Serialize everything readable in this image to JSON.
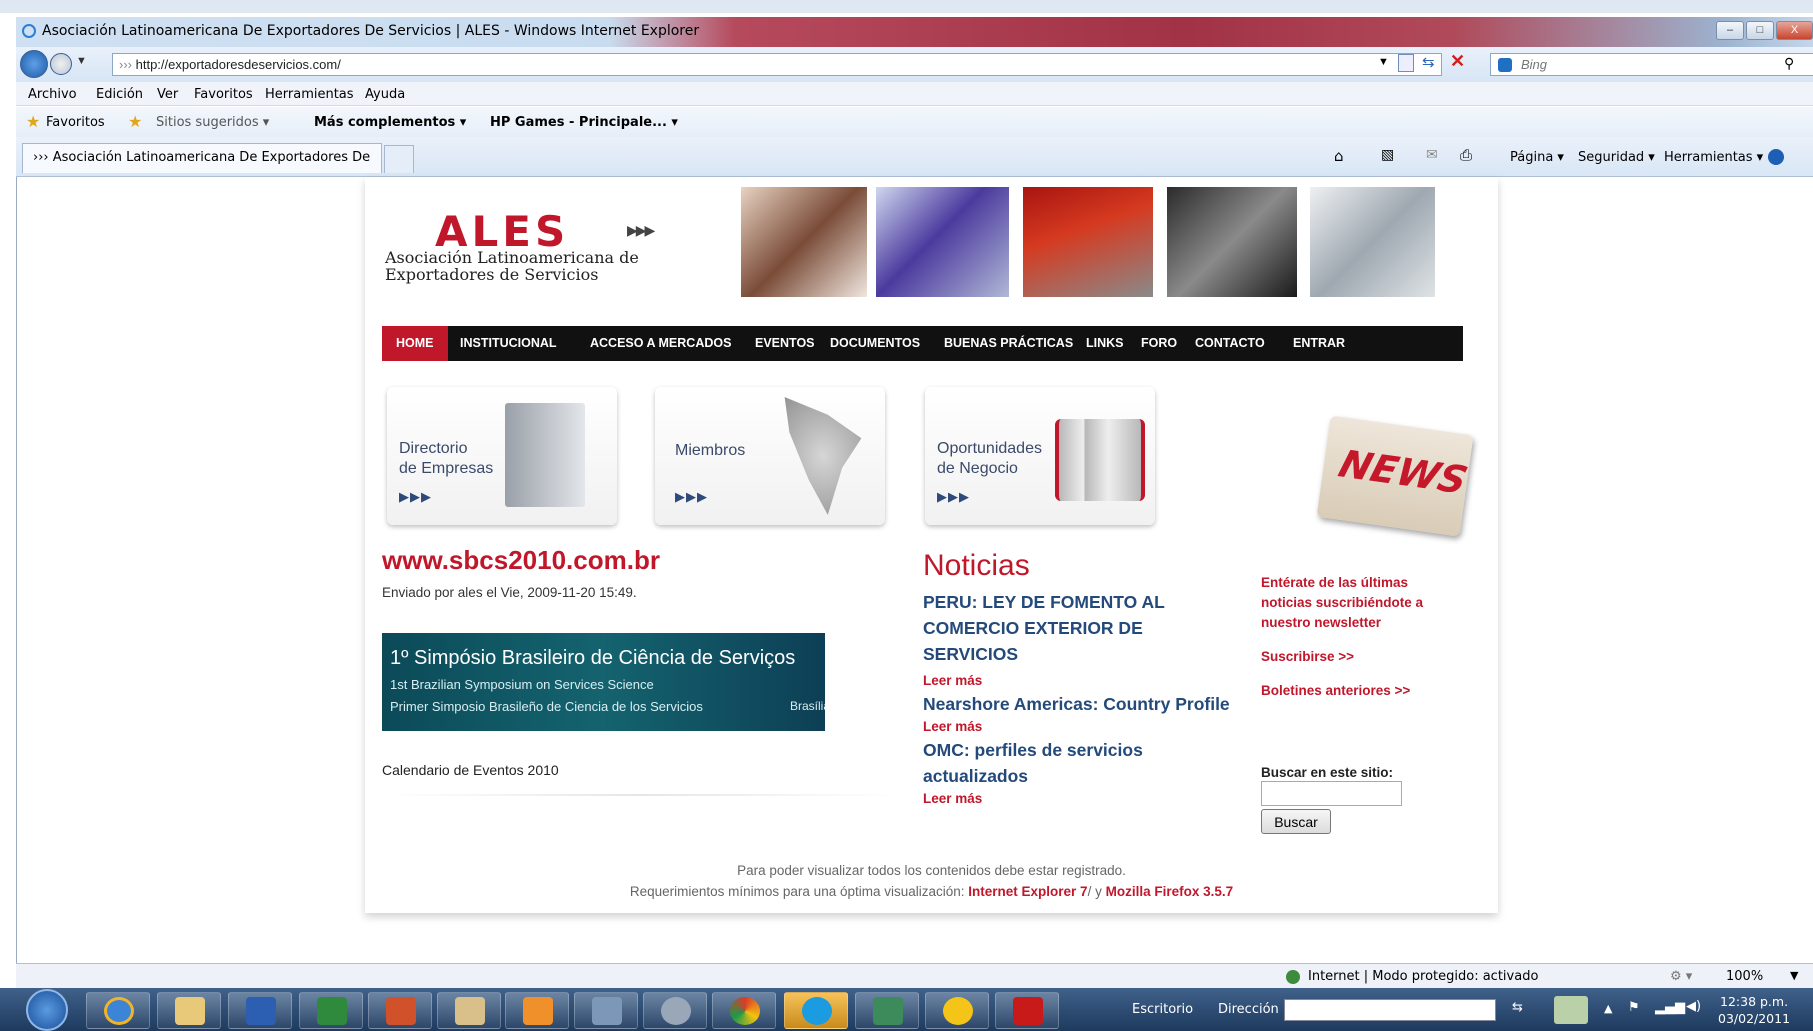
{
  "window": {
    "title": "Asociación Latinoamericana De Exportadores De Servicios | ALES - Windows Internet Explorer",
    "min": "–",
    "max": "□",
    "close": "X"
  },
  "nav": {
    "url": "http://exportadoresdeservicios.com/",
    "url_prefix": "›››",
    "search_placeholder": "Bing"
  },
  "menubar": [
    "Archivo",
    "Edición",
    "Ver",
    "Favoritos",
    "Herramientas",
    "Ayuda"
  ],
  "favbar": {
    "favoritos": "Favoritos",
    "sugeridos": "Sitios sugeridos ▾",
    "complementos": "Más complementos ▾",
    "hp": "HP Games - Principale... ▾"
  },
  "tab": {
    "label": "››› Asociación Latinoamericana De Exportadores De ..."
  },
  "cmdbar": {
    "pagina": "Página ▾",
    "seguridad": "Seguridad ▾",
    "herramientas": "Herramientas ▾"
  },
  "site": {
    "logo_word": "ALES",
    "logo_sub": "Asociación Latinoamericana de Exportadores de Servicios",
    "menu": [
      "HOME",
      "INSTITUCIONAL",
      "ACCESO A MERCADOS",
      "EVENTOS",
      "DOCUMENTOS",
      "BUENAS PRÁCTICAS",
      "LINKS",
      "FORO",
      "CONTACTO",
      "ENTRAR"
    ],
    "cards": [
      {
        "line1": "Directorio",
        "line2": "de Empresas",
        "arrows": "▶▶▶"
      },
      {
        "line1": "Miembros",
        "line2": "",
        "arrows": "▶▶▶"
      },
      {
        "line1": "Oportunidades",
        "line2": "de Negocio",
        "arrows": "▶▶▶"
      }
    ],
    "news_img": "NEWS",
    "article": {
      "title": "www.sbcs2010.com.br",
      "meta": "Enviado por ales el Vie, 2009-11-20 15:49.",
      "banner": {
        "l1": "1º Simpósio Brasileiro de Ciência de Serviços",
        "l2": "1st Brazilian Symposium on Services Science",
        "l3": "Primer Simposio Brasileño de Ciencia de los Servicios",
        "l4": "Brasília,"
      },
      "calendar": "Calendario de Eventos 2010"
    },
    "noticias": {
      "heading": "Noticias",
      "items": [
        {
          "title": "PERU: LEY DE FOMENTO AL COMERCIO EXTERIOR DE SERVICIOS",
          "more": "Leer más"
        },
        {
          "title": "Nearshore Americas: Country Profile",
          "more": "Leer más"
        },
        {
          "title": "OMC: perfiles de servicios actualizados",
          "more": "Leer más"
        }
      ]
    },
    "sidebar": {
      "newsletter": "Entérate de las últimas noticias suscribiéndote a nuestro newsletter",
      "suscribirse": "Suscribirse >>",
      "boletines": "Boletines anteriores >>",
      "search_label": "Buscar en este sitio:",
      "search_button": "Buscar"
    },
    "footer": {
      "line1": "Para poder visualizar todos los contenidos debe estar registrado.",
      "line2_prefix": "Requerimientos mínimos para una óptima visualización: ",
      "ie": "Internet Explorer 7",
      "sep": "/ y ",
      "ff": "Mozilla Firefox 3.5.7"
    }
  },
  "status": {
    "zone": "Internet | Modo protegido: activado",
    "zoom": "100%"
  },
  "taskbar": {
    "escritorio": "Escritorio",
    "direccion": "Dirección",
    "time": "12:38 p.m.",
    "date": "03/02/2011"
  }
}
